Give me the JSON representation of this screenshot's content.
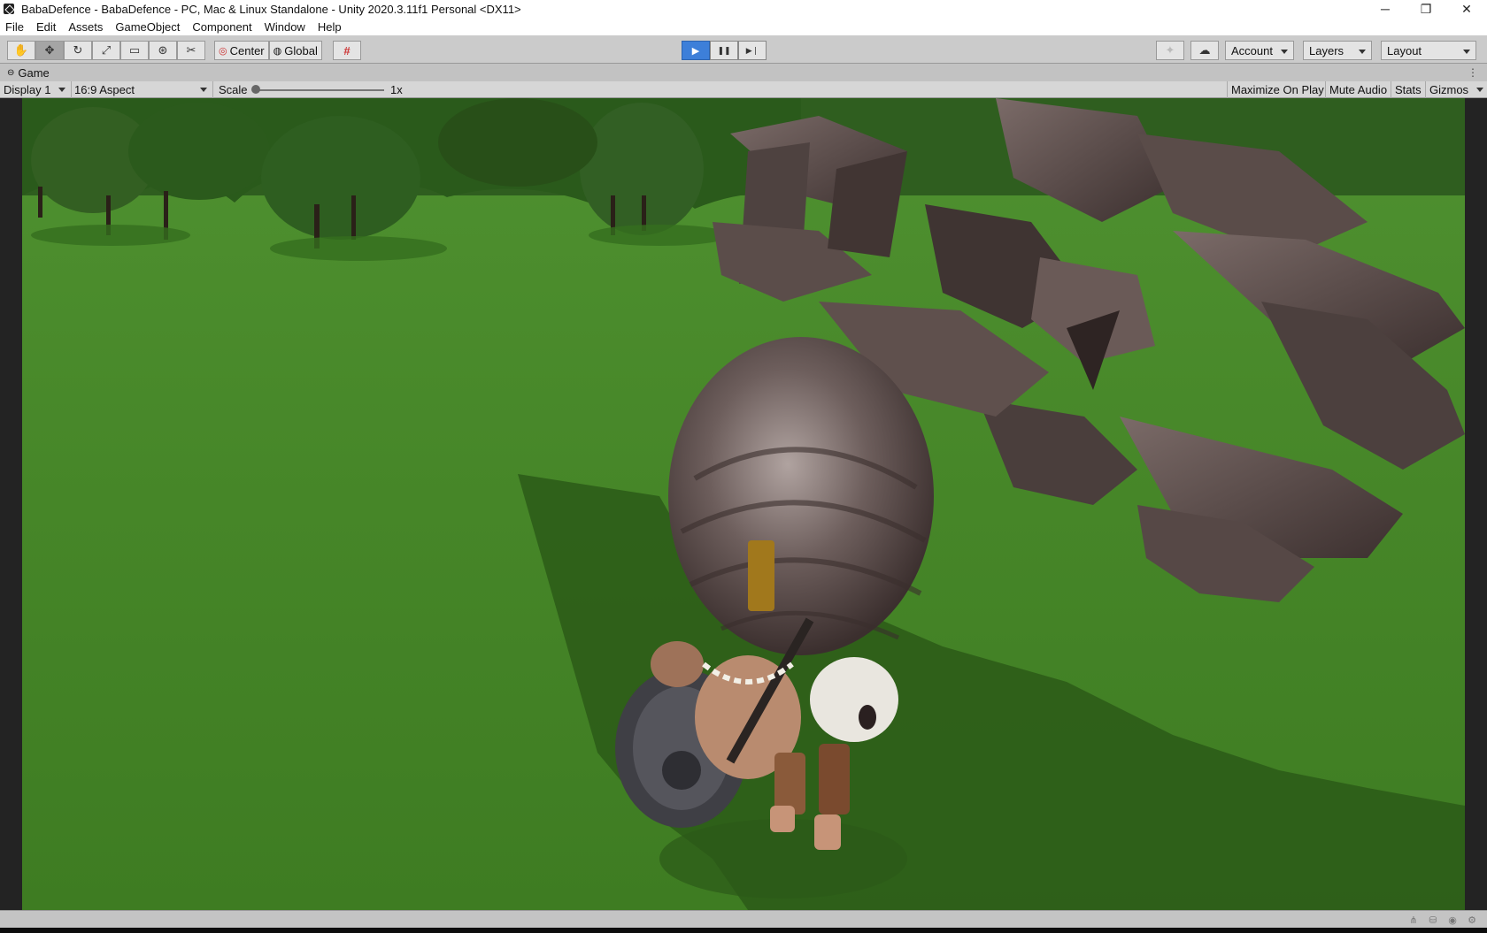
{
  "window": {
    "title": "BabaDefence - BabaDefence - PC, Mac & Linux Standalone - Unity 2020.3.11f1 Personal <DX11>",
    "minimize_glyph": "─",
    "restore_glyph": "❐",
    "close_glyph": "✕"
  },
  "menubar": {
    "items": [
      "File",
      "Edit",
      "Assets",
      "GameObject",
      "Component",
      "Window",
      "Help"
    ]
  },
  "toolbar": {
    "tools": [
      {
        "icon": "hand-icon",
        "glyph": "✋"
      },
      {
        "icon": "move-icon",
        "glyph": "✥"
      },
      {
        "icon": "rotate-icon",
        "glyph": "↻"
      },
      {
        "icon": "scale-icon",
        "glyph": "⤢"
      },
      {
        "icon": "rect-icon",
        "glyph": "▭"
      },
      {
        "icon": "transform-icon",
        "glyph": "⊛"
      },
      {
        "icon": "custom-tool-icon",
        "glyph": "✂"
      }
    ],
    "active_tool_index": 1,
    "pivot_label": "Center",
    "rotation_label": "Global",
    "snap_glyph": "#",
    "play_glyph": "▶",
    "pause_glyph": "❚❚",
    "step_glyph": "▶❘",
    "playing": true,
    "collab_glyph": "✦",
    "cloud_glyph": "☁",
    "account_label": "Account",
    "layers_label": "Layers",
    "layout_label": "Layout"
  },
  "game_tab": {
    "label": "Game",
    "menu_glyph": "⋮"
  },
  "game_toolbar": {
    "display": "Display 1",
    "aspect": "16:9 Aspect",
    "scale_label": "Scale",
    "scale_value": "1x",
    "maximize_on_play": "Maximize On Play",
    "mute_audio": "Mute Audio",
    "stats": "Stats",
    "gizmos": "Gizmos"
  },
  "colors": {
    "grass": "#4a8a2c",
    "grass_dark": "#3a7322",
    "tree": "#2e5a1f",
    "monster": "#5a4a48",
    "play_accent": "#3d7fd9"
  },
  "statusbar": {
    "icons": [
      "network-icon",
      "collab-status-icon",
      "services-icon",
      "settings-status-icon"
    ]
  }
}
